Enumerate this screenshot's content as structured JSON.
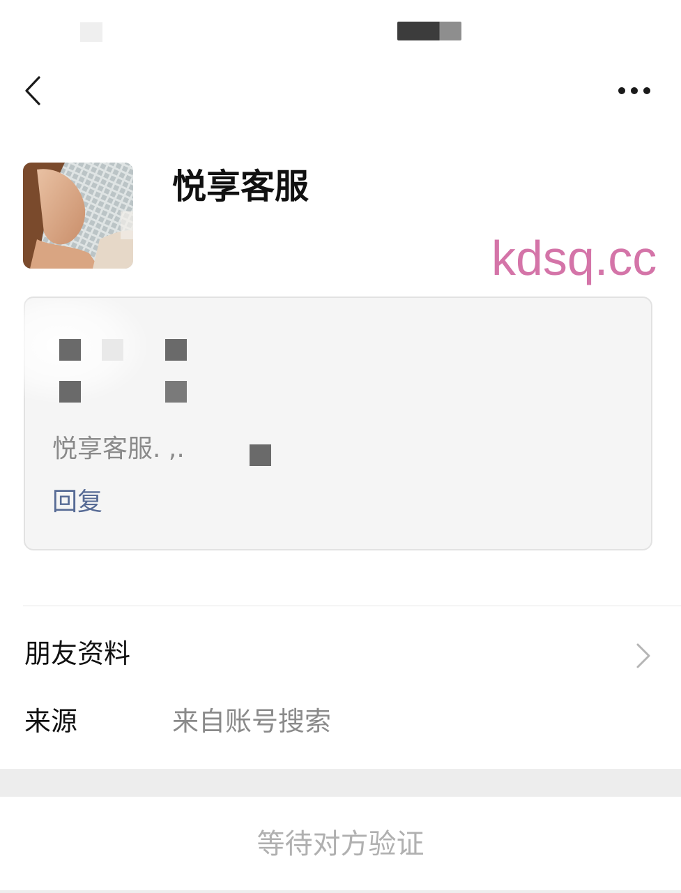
{
  "nav": {
    "back_icon": "chevron-left-icon",
    "more_icon": "more-dots-icon"
  },
  "profile": {
    "name": "悦享客服",
    "watermark": "kdsq.cc"
  },
  "message_card": {
    "text": "悦享客服. ,.",
    "reply_label": "回复"
  },
  "list": {
    "profile_row_label": "朋友资料",
    "source_label": "来源",
    "source_value": "来自账号搜索"
  },
  "footer": {
    "status_text": "等待对方验证"
  },
  "colors": {
    "link": "#576b95",
    "watermark": "#d474a8",
    "secondary_text": "#8a8a8a",
    "disabled_text": "#b0b0b0"
  }
}
